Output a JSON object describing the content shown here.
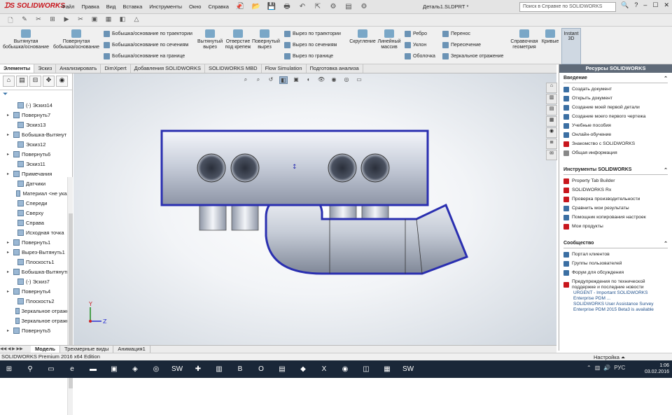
{
  "app": {
    "name": "SOLIDWORKS",
    "doc_title": "Деталь1.SLDPRT *"
  },
  "menu": [
    "Файл",
    "Правка",
    "Вид",
    "Вставка",
    "Инструменты",
    "Окно",
    "Справка"
  ],
  "search": {
    "placeholder": "Поиск в Справке по SOLIDWORKS"
  },
  "ribbon": {
    "extruded_boss": "Вытянутая бобышка/основание",
    "revolved_boss": "Повернутая бобышка/основание",
    "swept_boss": "Бобышка/основание по траектории",
    "lofted_boss": "Бобышка/основание по сечениям",
    "boundary_boss": "Бобышка/основание на границе",
    "extruded_cut": "Вытянутый вырез",
    "hole_wizard": "Отверстие под крепеж",
    "revolved_cut": "Повернутый вырез",
    "swept_cut": "Вырез по траектории",
    "lofted_cut": "Вырез по сечениям",
    "boundary_cut": "Вырез по границе",
    "fillet": "Скругление",
    "linear_pattern": "Линейный массив",
    "rib": "Ребро",
    "draft": "Уклон",
    "shell": "Оболочка",
    "wrap": "Перенос",
    "intersect": "Пересечение",
    "mirror": "Зеркальное отражение",
    "ref_geometry": "Справочная геометрия",
    "curves": "Кривые",
    "instant3d": "Instant 3D"
  },
  "tabs": [
    "Элементы",
    "Эскиз",
    "Анализировать",
    "DimXpert",
    "Добавления SOLIDWORKS",
    "SOLIDWORKS MBD",
    "Flow Simulation",
    "Подготовка анализа"
  ],
  "tree": {
    "items": [
      {
        "label": "(-) Эскиз14",
        "exp": ""
      },
      {
        "label": "Повернуть7",
        "exp": "▸"
      },
      {
        "label": "Эскиз13",
        "exp": ""
      },
      {
        "label": "Бобышка-Вытянут",
        "exp": "▸"
      },
      {
        "label": "Эскиз12",
        "exp": ""
      },
      {
        "label": "Повернуть6",
        "exp": "▸"
      },
      {
        "label": "Эскиз11",
        "exp": ""
      },
      {
        "label": "Примечания",
        "exp": "▸"
      },
      {
        "label": "Датчики",
        "exp": ""
      },
      {
        "label": "Материал <не указа",
        "exp": ""
      },
      {
        "label": "Спереди",
        "exp": ""
      },
      {
        "label": "Сверху",
        "exp": ""
      },
      {
        "label": "Справа",
        "exp": ""
      },
      {
        "label": "Исходная точка",
        "exp": ""
      },
      {
        "label": "Повернуть1",
        "exp": "▸"
      },
      {
        "label": "Вырез-Вытянуть1",
        "exp": "▸"
      },
      {
        "label": "Плоскость1",
        "exp": ""
      },
      {
        "label": "Бобышка-Вытянуть2",
        "exp": "▸"
      },
      {
        "label": "(-) Эскиз7",
        "exp": ""
      },
      {
        "label": "Повернуть4",
        "exp": "▸"
      },
      {
        "label": "Плоскость2",
        "exp": ""
      },
      {
        "label": "Зеркальное отражен",
        "exp": ""
      },
      {
        "label": "Зеркальное отражен",
        "exp": ""
      },
      {
        "label": "Повернуть5",
        "exp": "▸"
      }
    ]
  },
  "bottom_tabs": [
    "Модель",
    "Трехмерные виды",
    "Анимация1"
  ],
  "status": {
    "text": "SOLIDWORKS Premium 2016 x64 Edition",
    "settings": "Настройка"
  },
  "triad": {
    "y": "Y",
    "z": "Z"
  },
  "resources": {
    "title": "Ресурсы SOLIDWORKS",
    "intro": {
      "heading": "Введение",
      "items": [
        "Создать документ",
        "Открыть документ",
        "Создание моей первой детали",
        "Создание моего первого чертежа",
        "Учебные пособия",
        "Онлайн-обучение",
        "Знакомство с SOLIDWORKS",
        "Общая информация"
      ]
    },
    "tools": {
      "heading": "Инструменты SOLIDWORKS",
      "items": [
        "Property Tab Builder",
        "SOLIDWORKS Rx",
        "Проверка производительности",
        "Сравнить мои результаты",
        "Помощник копирования настроек",
        "Мои продукты"
      ]
    },
    "community": {
      "heading": "Сообщество",
      "items": [
        "Портал клиентов",
        "Группы пользователей",
        "Форум для обсуждения",
        "Предупреждения по технической поддержке и последние новости"
      ]
    },
    "news": [
      "URGENT - Important SOLIDWORKS Enterprise PDM ...",
      "SOLIDWORKS User Assistance Survey",
      "Enterprise PDM 2015 Beta3 is available"
    ]
  },
  "taskbar": {
    "lang": "РУС",
    "time": "1:06",
    "date": "03.02.2016"
  }
}
